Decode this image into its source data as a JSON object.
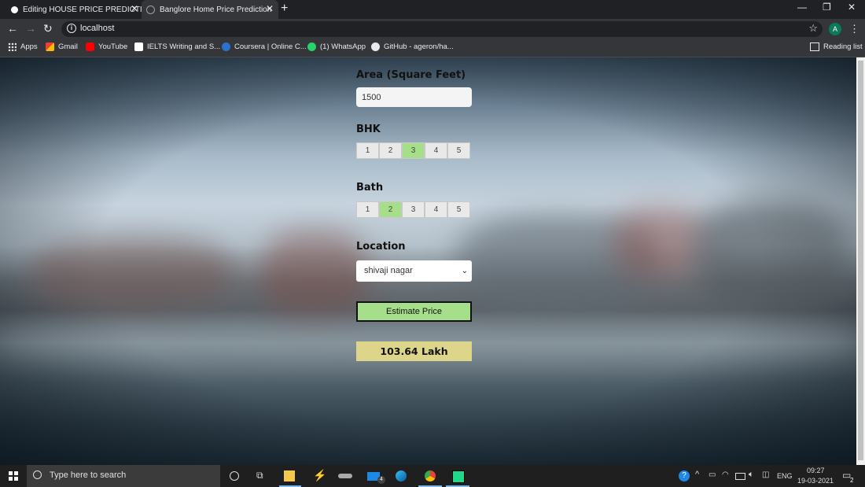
{
  "browser": {
    "tabs": [
      {
        "title": "Editing HOUSE PRICE PREDICTIO",
        "active": false
      },
      {
        "title": "Banglore Home Price Prediction",
        "active": true
      }
    ],
    "url": "localhost",
    "profile_initial": "A"
  },
  "bookmarks": {
    "items": [
      {
        "label": "Apps",
        "icon": "apps-grid-icon"
      },
      {
        "label": "Gmail",
        "icon": "gmail-icon"
      },
      {
        "label": "YouTube",
        "icon": "youtube-icon"
      },
      {
        "label": "IELTS Writing and S...",
        "icon": "ielts-icon"
      },
      {
        "label": "Coursera | Online C...",
        "icon": "coursera-icon"
      },
      {
        "label": "(1) WhatsApp",
        "icon": "whatsapp-icon"
      },
      {
        "label": "GitHub - ageron/ha...",
        "icon": "github-icon"
      }
    ],
    "reading_list": "Reading list"
  },
  "form": {
    "area_label": "Area (Square Feet)",
    "area_value": "1500",
    "bhk_label": "BHK",
    "bhk_options": [
      "1",
      "2",
      "3",
      "4",
      "5"
    ],
    "bhk_selected": "3",
    "bath_label": "Bath",
    "bath_options": [
      "1",
      "2",
      "3",
      "4",
      "5"
    ],
    "bath_selected": "2",
    "location_label": "Location",
    "location_value": "shivaji nagar",
    "estimate_button": "Estimate Price",
    "result": "103.64 Lakh"
  },
  "colors": {
    "selected_option": "#a6df8a",
    "result_bg": "#ddd58a"
  },
  "taskbar": {
    "search_placeholder": "Type here to search",
    "mail_badge": "4",
    "language": "ENG",
    "time": "09:27",
    "date": "19-03-2021",
    "notification_count": "2"
  }
}
